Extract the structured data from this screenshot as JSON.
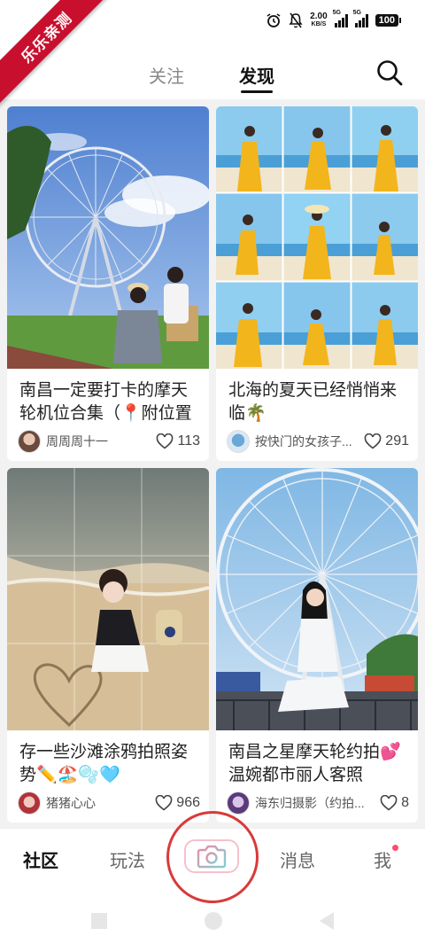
{
  "status_bar": {
    "watermark": "乐乐亲测",
    "net_speed": "2.00",
    "net_speed_unit": "KB/S",
    "signal_1": "5G",
    "signal_2": "5G",
    "battery": "100",
    "icons": [
      "alarm-icon",
      "mute-icon"
    ]
  },
  "top_nav": {
    "tab_follow": "关注",
    "tab_discover": "发现",
    "active_tab": "发现",
    "search_icon": "search-icon"
  },
  "feed": {
    "cards": [
      {
        "title": "南昌一定要打卡的摩天轮机位合集（📍附位置",
        "author": "周周周十一",
        "likes": "113"
      },
      {
        "title": "北海的夏天已经悄悄来临🌴",
        "author": "按快门的女孩子...",
        "likes": "291"
      },
      {
        "title": "存一些沙滩涂鸦拍照姿势✏️🏖️🫧🩵",
        "author": "猪猪心心",
        "likes": "966"
      },
      {
        "title": "南昌之星摩天轮约拍💕温婉都市丽人客照",
        "author": "海东归摄影（约拍...",
        "likes": "8"
      }
    ]
  },
  "bottom_nav": {
    "community": "社区",
    "play": "玩法",
    "camera_icon": "camera-icon",
    "messages": "消息",
    "me": "我"
  },
  "colors": {
    "ribbon": "#c8102e",
    "highlight_circle": "#d93a3a",
    "notification_dot": "#ff4d6d"
  }
}
